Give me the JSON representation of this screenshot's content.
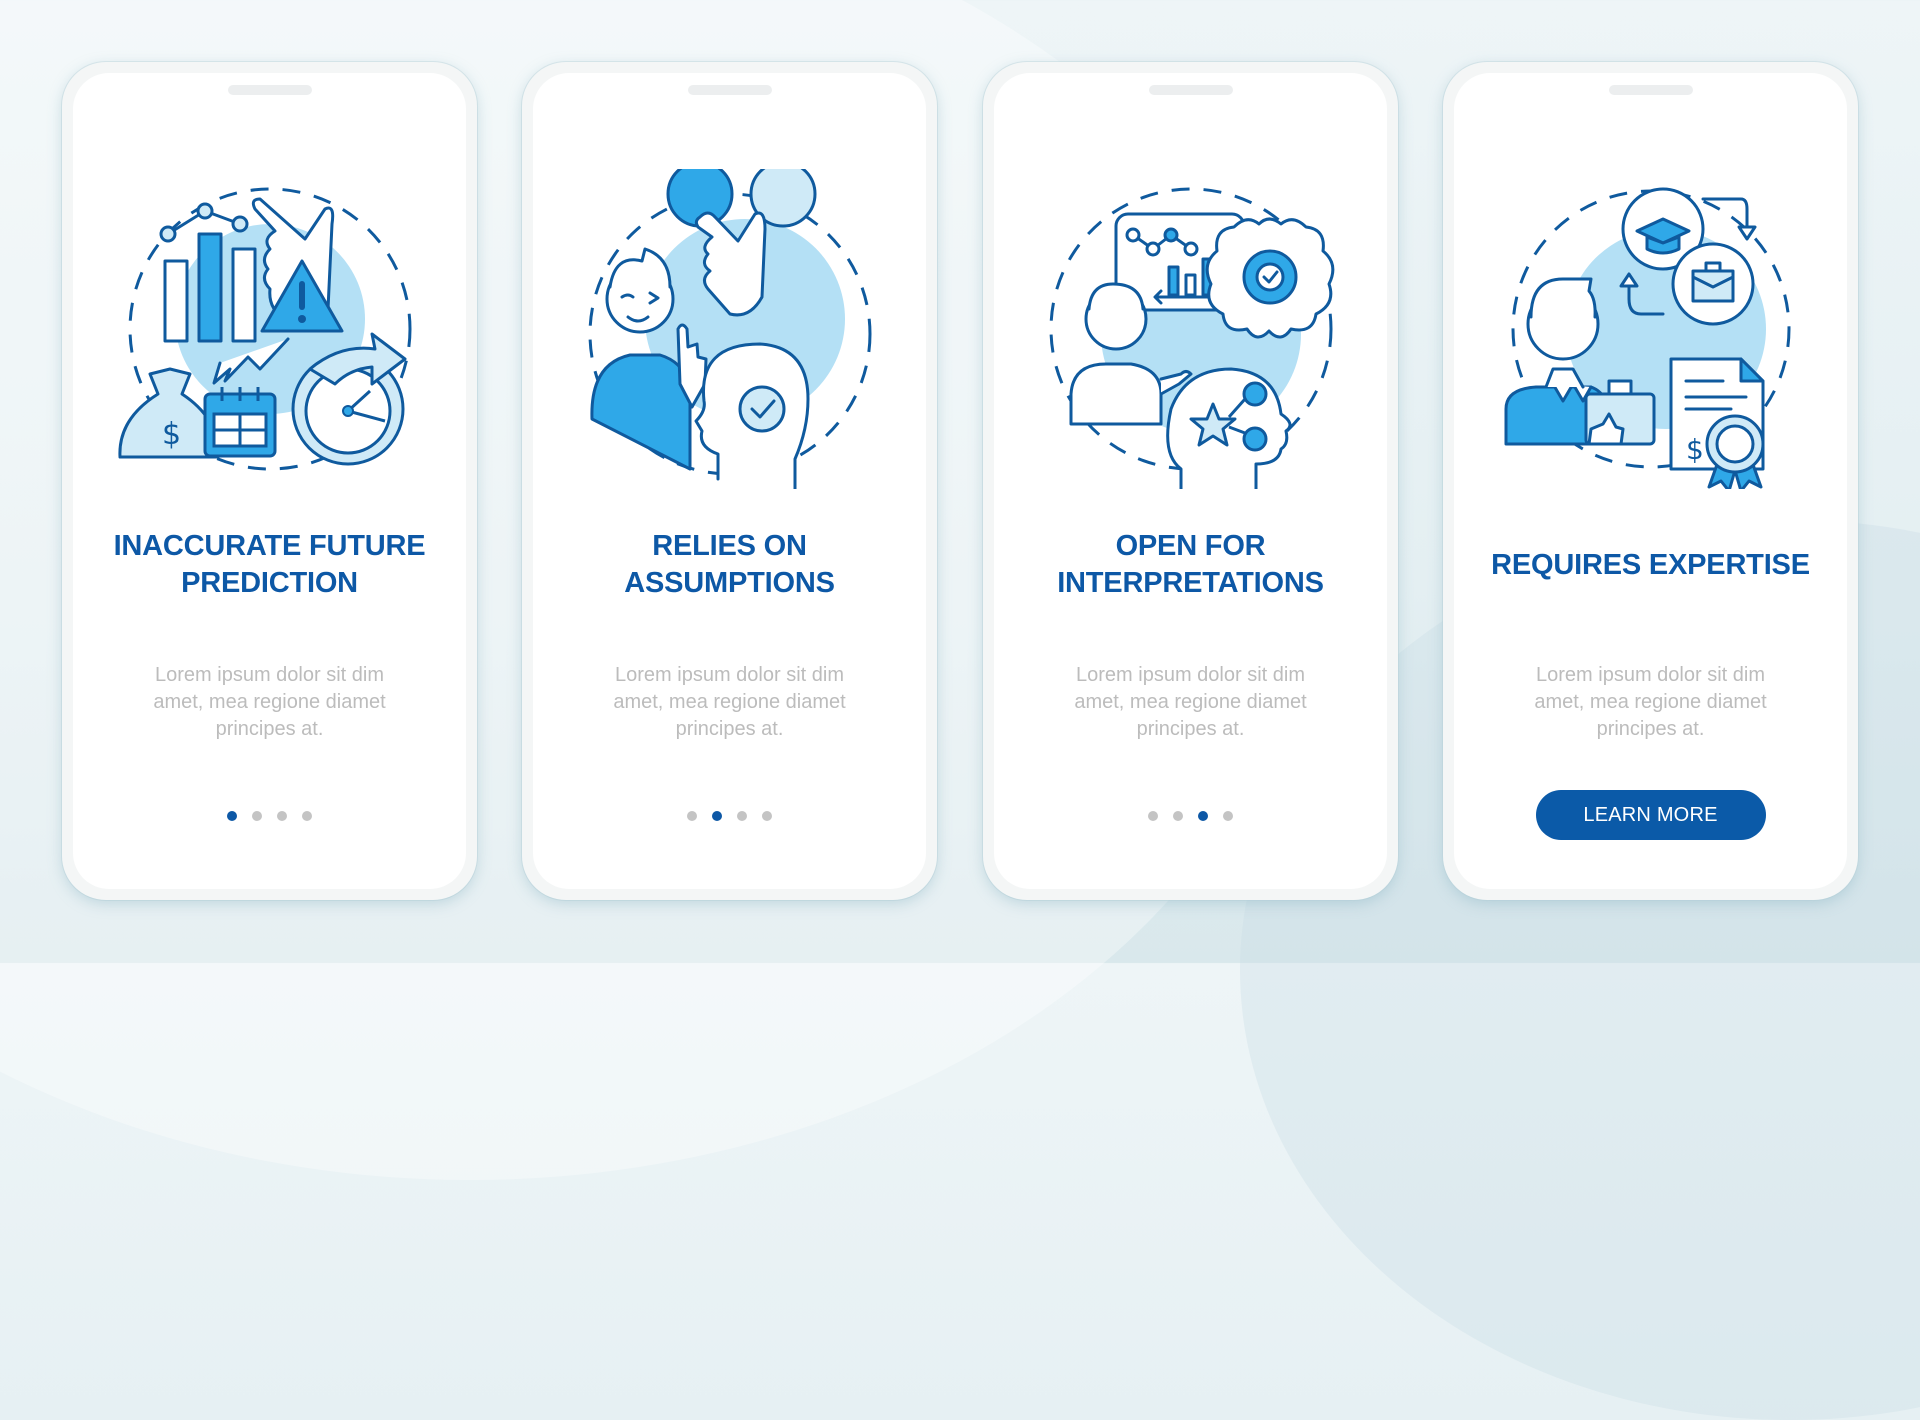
{
  "theme": {
    "accent": "#0d58a6",
    "button": "#0b5aa8",
    "illustration_fill": "#2fa8e8",
    "illustration_light": "#b4e0f5",
    "body_text": "#bcbcbc",
    "dot_inactive": "#c4c4c4"
  },
  "screens": [
    {
      "illustration": "forecast-risk-illustration",
      "title_lines": [
        "INACCURATE FUTURE",
        "PREDICTION"
      ],
      "description_lines": [
        "Lorem ipsum dolor sit dim",
        "amet, mea regione diamet",
        "principes at."
      ],
      "pager": {
        "current": 1,
        "total": 4
      }
    },
    {
      "illustration": "assumption-choice-illustration",
      "title_lines": [
        "RELIES ON",
        "ASSUMPTIONS"
      ],
      "description_lines": [
        "Lorem ipsum dolor sit dim",
        "amet, mea regione diamet",
        "principes at."
      ],
      "pager": {
        "current": 2,
        "total": 4
      }
    },
    {
      "illustration": "interpretation-analysis-illustration",
      "title_lines": [
        "OPEN FOR",
        "INTERPRETATIONS"
      ],
      "description_lines": [
        "Lorem ipsum dolor sit dim",
        "amet, mea regione diamet",
        "principes at."
      ],
      "pager": {
        "current": 3,
        "total": 4
      }
    },
    {
      "illustration": "expertise-career-illustration",
      "title_lines": [
        "REQUIRES EXPERTISE"
      ],
      "description_lines": [
        "Lorem ipsum dolor sit dim",
        "amet, mea regione diamet",
        "principes at."
      ],
      "button_label": "LEARN MORE"
    }
  ]
}
